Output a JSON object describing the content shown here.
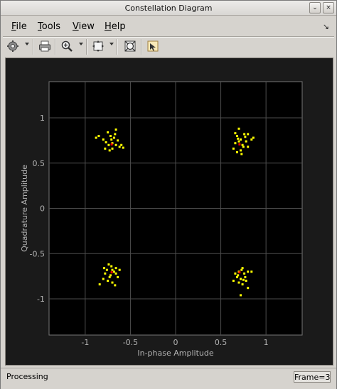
{
  "window": {
    "title": "Constellation Diagram",
    "minimize_glyph": "⌄",
    "close_glyph": "×"
  },
  "menu": {
    "items": [
      {
        "key": "F",
        "rest": "ile"
      },
      {
        "key": "T",
        "rest": "ools"
      },
      {
        "key": "V",
        "rest": "iew"
      },
      {
        "key": "H",
        "rest": "elp"
      }
    ],
    "dock_glyph": "↘"
  },
  "toolbar": {
    "icons": [
      "gear-icon",
      "print-icon",
      "zoom-in-icon",
      "fit-to-view-icon",
      "scope-settings-icon",
      "highlight-icon"
    ]
  },
  "status": {
    "text": "Processing",
    "frame_label": "Frame=3"
  },
  "colors": {
    "plot_background": "#000000",
    "axes_text": "#b3b3b3",
    "grid": "#4d4d4d",
    "points": "#ffff00",
    "reference": "#ff0000"
  },
  "chart_data": {
    "type": "scatter",
    "xlabel": "In-phase Amplitude",
    "ylabel": "Quadrature Amplitude",
    "xlim": [
      -1.4,
      1.4
    ],
    "ylim": [
      -1.4,
      1.4
    ],
    "xticks": [
      "-1",
      "-0.5",
      "0",
      "0.5",
      "1"
    ],
    "xtick_values": [
      -1,
      -0.5,
      0,
      0.5,
      1
    ],
    "yticks": [
      "1",
      "0.5",
      "0",
      "-0.5",
      "-1"
    ],
    "ytick_values": [
      1,
      0.5,
      0,
      -0.5,
      -1
    ],
    "grid": true,
    "reference_points": [
      [
        -0.7071,
        0.7071
      ],
      [
        0.7071,
        0.7071
      ],
      [
        -0.7071,
        -0.7071
      ],
      [
        0.7071,
        -0.7071
      ]
    ],
    "series": [
      {
        "points": [
          [
            -0.72,
            0.8
          ],
          [
            -0.68,
            0.78
          ],
          [
            -0.75,
            0.84
          ],
          [
            -0.8,
            0.76
          ],
          [
            -0.7,
            0.72
          ],
          [
            -0.74,
            0.7
          ],
          [
            -0.66,
            0.7
          ],
          [
            -0.62,
            0.68
          ],
          [
            -0.78,
            0.66
          ],
          [
            -0.73,
            0.64
          ],
          [
            -0.64,
            0.75
          ],
          [
            -0.6,
            0.7
          ],
          [
            -0.85,
            0.8
          ],
          [
            -0.7,
            0.66
          ],
          [
            -0.77,
            0.73
          ],
          [
            -0.67,
            0.82
          ],
          [
            -0.71,
            0.76
          ],
          [
            -0.88,
            0.78
          ],
          [
            -0.66,
            0.87
          ],
          [
            -0.58,
            0.67
          ],
          [
            0.68,
            0.8
          ],
          [
            0.72,
            0.76
          ],
          [
            0.76,
            0.82
          ],
          [
            0.7,
            0.88
          ],
          [
            0.66,
            0.72
          ],
          [
            0.74,
            0.7
          ],
          [
            0.78,
            0.74
          ],
          [
            0.72,
            0.64
          ],
          [
            0.68,
            0.62
          ],
          [
            0.8,
            0.68
          ],
          [
            0.84,
            0.76
          ],
          [
            0.64,
            0.66
          ],
          [
            0.7,
            0.74
          ],
          [
            0.77,
            0.79
          ],
          [
            0.73,
            0.6
          ],
          [
            0.66,
            0.83
          ],
          [
            0.75,
            0.68
          ],
          [
            0.8,
            0.82
          ],
          [
            0.69,
            0.77
          ],
          [
            0.86,
            0.78
          ],
          [
            -0.74,
            -0.62
          ],
          [
            -0.7,
            -0.68
          ],
          [
            -0.66,
            -0.66
          ],
          [
            -0.78,
            -0.72
          ],
          [
            -0.72,
            -0.74
          ],
          [
            -0.64,
            -0.76
          ],
          [
            -0.75,
            -0.8
          ],
          [
            -0.7,
            -0.82
          ],
          [
            -0.68,
            -0.7
          ],
          [
            -0.8,
            -0.78
          ],
          [
            -0.84,
            -0.84
          ],
          [
            -0.67,
            -0.85
          ],
          [
            -0.62,
            -0.68
          ],
          [
            -0.76,
            -0.68
          ],
          [
            -0.73,
            -0.76
          ],
          [
            -0.66,
            -0.72
          ],
          [
            -0.71,
            -0.64
          ],
          [
            -0.79,
            -0.66
          ],
          [
            0.74,
            -0.66
          ],
          [
            0.7,
            -0.7
          ],
          [
            0.76,
            -0.72
          ],
          [
            0.68,
            -0.76
          ],
          [
            0.72,
            -0.78
          ],
          [
            0.78,
            -0.8
          ],
          [
            0.8,
            -0.7
          ],
          [
            0.66,
            -0.72
          ],
          [
            0.7,
            -0.82
          ],
          [
            0.74,
            -0.84
          ],
          [
            0.8,
            -0.88
          ],
          [
            0.72,
            -0.96
          ],
          [
            0.64,
            -0.8
          ],
          [
            0.84,
            -0.7
          ],
          [
            0.73,
            -0.68
          ],
          [
            0.77,
            -0.76
          ],
          [
            0.69,
            -0.74
          ],
          [
            0.75,
            -0.79
          ]
        ]
      }
    ]
  }
}
